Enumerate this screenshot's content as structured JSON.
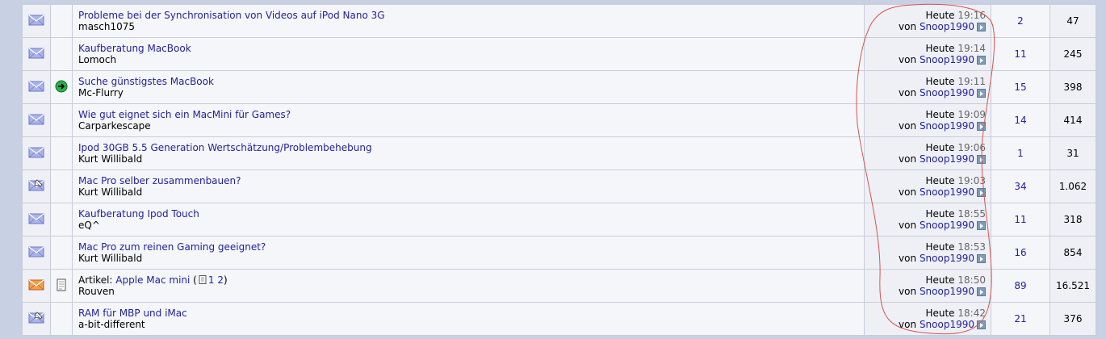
{
  "threads": [
    {
      "status_icon": "envelope-icon",
      "post_icon": "",
      "prefix": "",
      "title": "Probleme bei der Synchronisation von Videos auf iPod Nano 3G",
      "pages": [],
      "author": "masch1075",
      "lastpost_day": "Heute",
      "lastpost_time": "19:16",
      "lastpost_by": "von",
      "lastpost_user": "Snoop1990",
      "replies": "2",
      "views": "47"
    },
    {
      "status_icon": "envelope-icon",
      "post_icon": "",
      "prefix": "",
      "title": "Kaufberatung MacBook",
      "pages": [],
      "author": "Lomoch",
      "lastpost_day": "Heute",
      "lastpost_time": "19:14",
      "lastpost_by": "von",
      "lastpost_user": "Snoop1990",
      "replies": "11",
      "views": "245"
    },
    {
      "status_icon": "envelope-icon",
      "post_icon": "arrow-icon",
      "prefix": "",
      "title": "Suche günstigstes MacBook",
      "pages": [],
      "author": "Mc-Flurry",
      "lastpost_day": "Heute",
      "lastpost_time": "19:11",
      "lastpost_by": "von",
      "lastpost_user": "Snoop1990",
      "replies": "15",
      "views": "398"
    },
    {
      "status_icon": "envelope-icon",
      "post_icon": "",
      "prefix": "",
      "title": "Wie gut eignet sich ein MacMini für Games?",
      "pages": [],
      "author": "Carparkescape",
      "lastpost_day": "Heute",
      "lastpost_time": "19:09",
      "lastpost_by": "von",
      "lastpost_user": "Snoop1990",
      "replies": "14",
      "views": "414"
    },
    {
      "status_icon": "envelope-icon",
      "post_icon": "",
      "prefix": "",
      "title": "Ipod 30GB 5.5 Generation Wertschätzung/Problembehebung",
      "pages": [],
      "author": "Kurt Willibald",
      "lastpost_day": "Heute",
      "lastpost_time": "19:06",
      "lastpost_by": "von",
      "lastpost_user": "Snoop1990",
      "replies": "1",
      "views": "31"
    },
    {
      "status_icon": "envelope-posted-icon",
      "post_icon": "",
      "prefix": "",
      "title": "Mac Pro selber zusammenbauen?",
      "pages": [],
      "author": "Kurt Willibald",
      "lastpost_day": "Heute",
      "lastpost_time": "19:03",
      "lastpost_by": "von",
      "lastpost_user": "Snoop1990",
      "replies": "34",
      "views": "1.062"
    },
    {
      "status_icon": "envelope-icon",
      "post_icon": "",
      "prefix": "",
      "title": "Kaufberatung Ipod Touch",
      "pages": [],
      "author": "eQ^",
      "lastpost_day": "Heute",
      "lastpost_time": "18:55",
      "lastpost_by": "von",
      "lastpost_user": "Snoop1990",
      "replies": "11",
      "views": "318"
    },
    {
      "status_icon": "envelope-icon",
      "post_icon": "",
      "prefix": "",
      "title": "Mac Pro zum reinen Gaming geeignet?",
      "pages": [],
      "author": "Kurt Willibald",
      "lastpost_day": "Heute",
      "lastpost_time": "18:53",
      "lastpost_by": "von",
      "lastpost_user": "Snoop1990",
      "replies": "16",
      "views": "854"
    },
    {
      "status_icon": "envelope-hot-icon",
      "post_icon": "document-icon",
      "prefix": "Artikel:",
      "title": "Apple Mac mini",
      "pages": [
        "1",
        "2"
      ],
      "author": "Rouven",
      "lastpost_day": "Heute",
      "lastpost_time": "18:50",
      "lastpost_by": "von",
      "lastpost_user": "Snoop1990",
      "replies": "89",
      "views": "16.521"
    },
    {
      "status_icon": "envelope-posted-icon",
      "post_icon": "",
      "prefix": "",
      "title": "RAM für MBP und iMac",
      "pages": [],
      "author": "a-bit-different",
      "lastpost_day": "Heute",
      "lastpost_time": "18:42",
      "lastpost_by": "von",
      "lastpost_user": "Snoop1990",
      "replies": "21",
      "views": "376"
    }
  ],
  "colors": {
    "link": "#22229c",
    "annotation_circle": "#d9534f",
    "envelope": "#9ea9e6",
    "envelope_hot": "#f0a040",
    "arrow_icon": "#2bb24c"
  }
}
